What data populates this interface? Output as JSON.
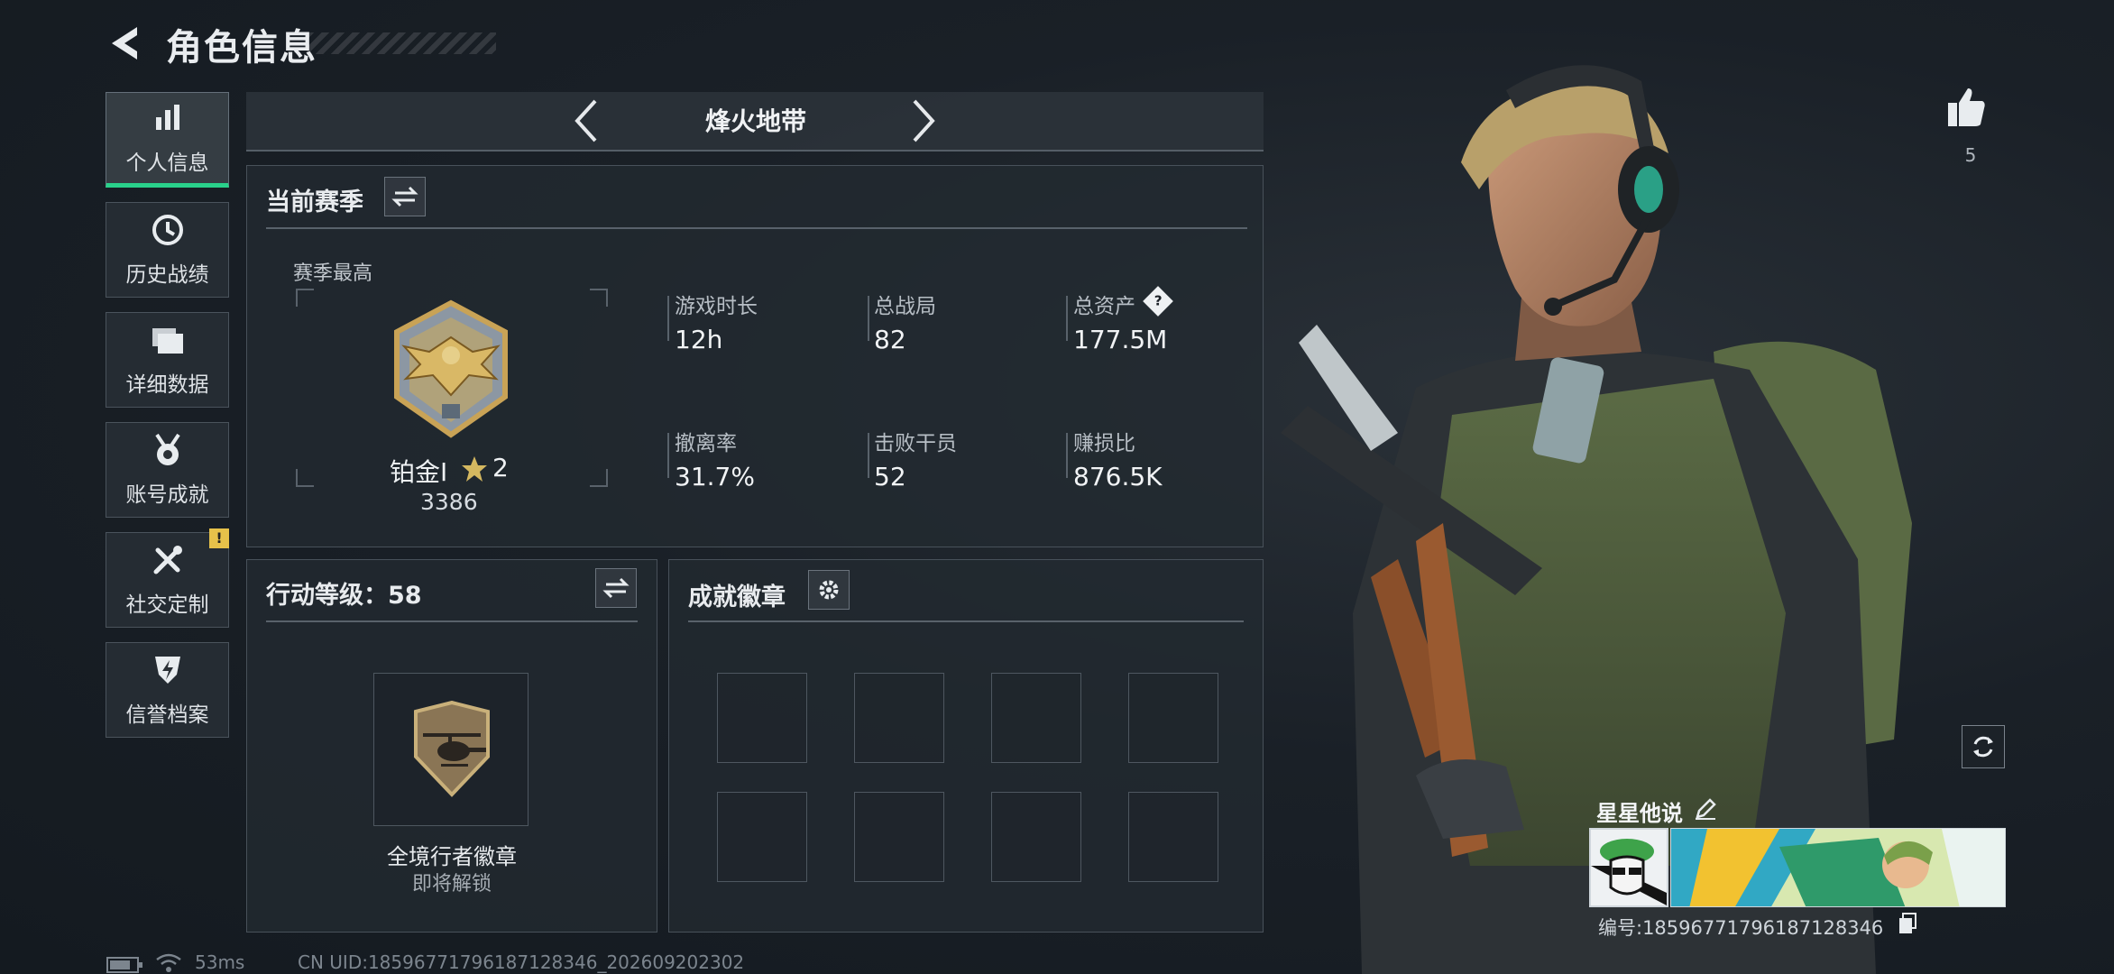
{
  "header": {
    "title": "角色信息"
  },
  "sidebar": {
    "items": [
      {
        "label": "个人信息",
        "icon": "bar-chart-icon",
        "active": true
      },
      {
        "label": "历史战绩",
        "icon": "history-icon"
      },
      {
        "label": "详细数据",
        "icon": "folder-icon"
      },
      {
        "label": "账号成就",
        "icon": "medal-icon"
      },
      {
        "label": "社交定制",
        "icon": "tools-icon",
        "badge": "!"
      },
      {
        "label": "信誉档案",
        "icon": "shield-bolt-icon"
      }
    ]
  },
  "map_selector": {
    "name": "烽火地带"
  },
  "season": {
    "title": "当前赛季",
    "best_label": "赛季最高",
    "rank_name": "铂金Ⅰ",
    "rank_stars": "2",
    "rank_score": "3386",
    "stats": [
      {
        "label": "游戏时长",
        "value": "12h"
      },
      {
        "label": "总战局",
        "value": "82"
      },
      {
        "label": "总资产",
        "value": "177.5M",
        "help": "?"
      },
      {
        "label": "撤离率",
        "value": "31.7%"
      },
      {
        "label": "击败干员",
        "value": "52"
      },
      {
        "label": "赚损比",
        "value": "876.5K"
      }
    ]
  },
  "action_level": {
    "title": "行动等级：58",
    "badge_name": "全境行者徽章",
    "badge_status": "即将解锁"
  },
  "achievements": {
    "title": "成就徽章",
    "slots": 8
  },
  "like": {
    "count": "5"
  },
  "player": {
    "name": "星星他说",
    "id_text": "编号:18596771796187128346"
  },
  "status": {
    "ping": "53ms",
    "uid": "CN UID:18596771796187128346_202609202302"
  },
  "colors": {
    "accent": "#29d18b",
    "badge": "#e6c14a",
    "gold": "#c9a356"
  }
}
